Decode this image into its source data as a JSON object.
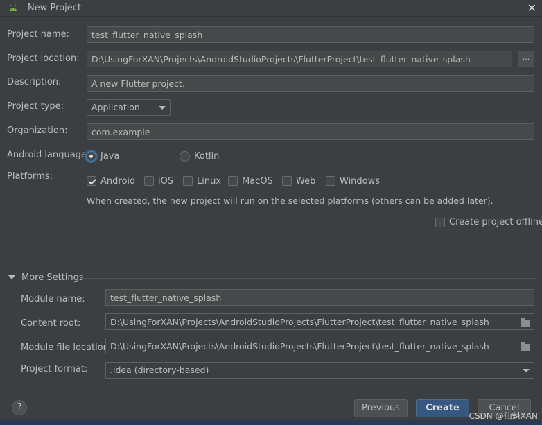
{
  "window": {
    "title": "New Project",
    "close_glyph": "✕",
    "icon": "android-icon"
  },
  "form": {
    "project_name_label": "Project name:",
    "project_name_value": "test_flutter_native_splash",
    "project_location_label": "Project location:",
    "project_location_value": "D:\\UsingForXAN\\Projects\\AndroidStudioProjects\\FlutterProject\\test_flutter_native_splash",
    "browse_label": "...",
    "description_label": "Description:",
    "description_value": "A new Flutter project.",
    "project_type_label": "Project type:",
    "project_type_value": "Application",
    "organization_label": "Organization:",
    "organization_value": "com.example",
    "android_language_label": "Android language:",
    "language_java": "Java",
    "language_kotlin": "Kotlin",
    "language_selected": "Java",
    "platforms_label": "Platforms:",
    "platforms": [
      {
        "label": "Android",
        "checked": true
      },
      {
        "label": "iOS",
        "checked": false
      },
      {
        "label": "Linux",
        "checked": false
      },
      {
        "label": "MacOS",
        "checked": false
      },
      {
        "label": "Web",
        "checked": false
      },
      {
        "label": "Windows",
        "checked": false
      }
    ],
    "platforms_note": "When created, the new project will run on the selected platforms (others can be added later).",
    "offline_label": "Create project offline",
    "offline_checked": false
  },
  "more_settings": {
    "header": "More Settings",
    "module_name_label": "Module name:",
    "module_name_value": "test_flutter_native_splash",
    "content_root_label": "Content root:",
    "content_root_value": "D:\\UsingForXAN\\Projects\\AndroidStudioProjects\\FlutterProject\\test_flutter_native_splash",
    "module_file_location_label": "Module file location:",
    "module_file_location_value": "D:\\UsingForXAN\\Projects\\AndroidStudioProjects\\FlutterProject\\test_flutter_native_splash",
    "project_format_label": "Project format:",
    "project_format_value": ".idea (directory-based)"
  },
  "footer": {
    "help_glyph": "?",
    "previous_label": "Previous",
    "create_label": "Create",
    "cancel_label": "Cancel",
    "watermark": "CSDN @仙魁XAN"
  },
  "colors": {
    "background": "#3c3f41",
    "field": "#45494a",
    "primary_button": "#365880",
    "accent": "#4a88c7"
  }
}
